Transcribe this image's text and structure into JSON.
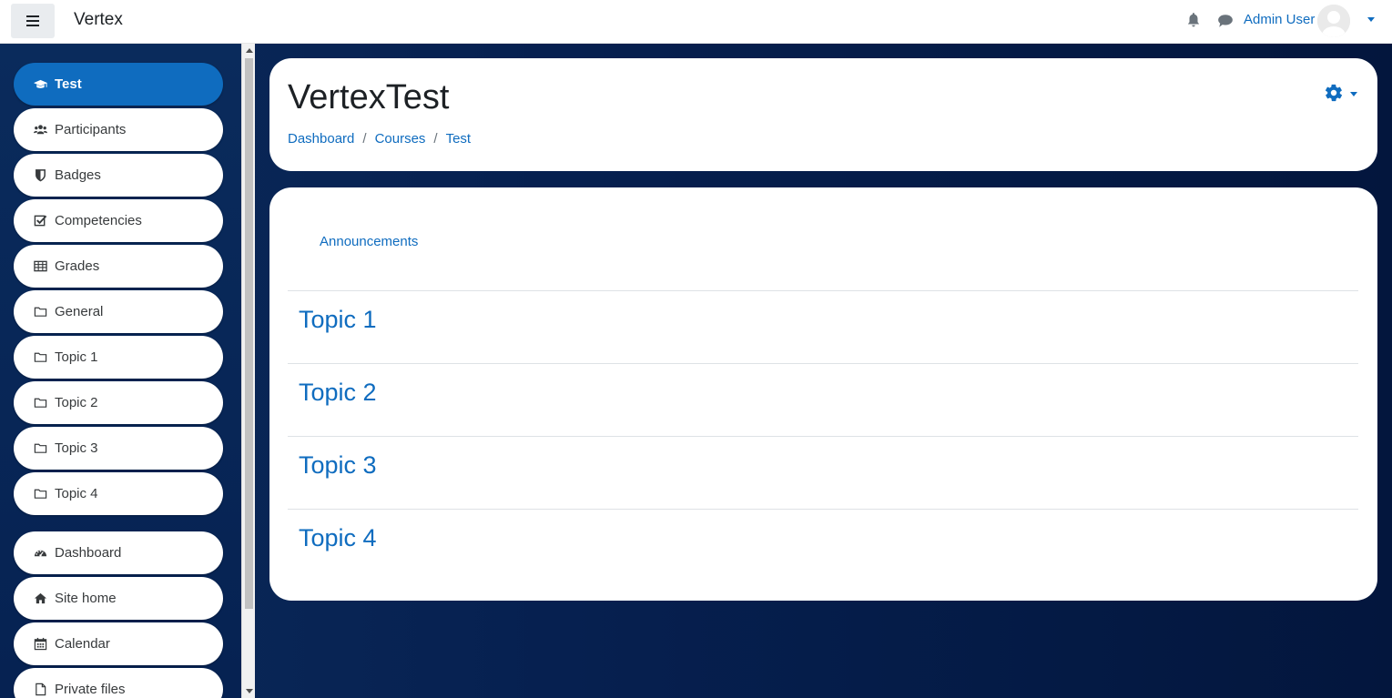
{
  "navbar": {
    "brand": "Vertex",
    "user_name": "Admin User",
    "icons": [
      "menu-icon",
      "bell-icon",
      "chat-icon",
      "avatar",
      "caret-down-icon"
    ]
  },
  "sidebar": {
    "items": [
      {
        "label": "Test",
        "icon": "graduation-cap-icon",
        "active": true
      },
      {
        "label": "Participants",
        "icon": "users-icon"
      },
      {
        "label": "Badges",
        "icon": "shield-icon"
      },
      {
        "label": "Competencies",
        "icon": "check-square-icon"
      },
      {
        "label": "Grades",
        "icon": "table-icon"
      },
      {
        "label": "General",
        "icon": "folder-icon"
      },
      {
        "label": "Topic 1",
        "icon": "folder-icon"
      },
      {
        "label": "Topic 2",
        "icon": "folder-icon"
      },
      {
        "label": "Topic 3",
        "icon": "folder-icon"
      },
      {
        "label": "Topic 4",
        "icon": "folder-icon"
      }
    ],
    "items2": [
      {
        "label": "Dashboard",
        "icon": "dashboard-icon"
      },
      {
        "label": "Site home",
        "icon": "home-icon"
      },
      {
        "label": "Calendar",
        "icon": "calendar-icon"
      },
      {
        "label": "Private files",
        "icon": "file-icon"
      }
    ]
  },
  "header": {
    "title": "VertexTest",
    "breadcrumb": [
      "Dashboard",
      "Courses",
      "Test"
    ]
  },
  "content": {
    "announcements": "Announcements",
    "sections": [
      "Topic 1",
      "Topic 2",
      "Topic 3",
      "Topic 4"
    ]
  },
  "colors": {
    "accent": "#0f6cbf",
    "background": "#062050"
  }
}
